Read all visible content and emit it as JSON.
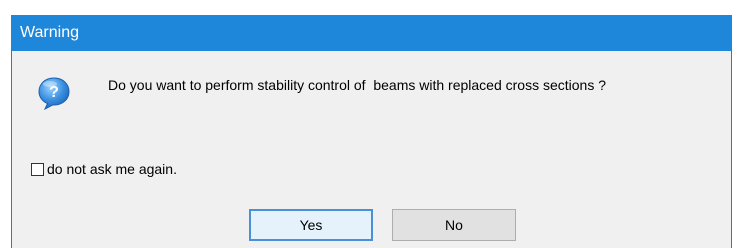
{
  "window": {
    "title": "Warning"
  },
  "dialog": {
    "icon": "question-icon",
    "message": "Do you want to perform stability control of  beams with replaced cross sections ?",
    "checkbox_label": "do not ask me again.",
    "checkbox_checked": false
  },
  "buttons": {
    "yes_label": "Yes",
    "no_label": "No"
  },
  "colors": {
    "titlebar": "#1f87d9",
    "dialog_bg": "#f0f0f0",
    "button_bg": "#e1e1e1",
    "default_button_border": "#4a90d9"
  }
}
